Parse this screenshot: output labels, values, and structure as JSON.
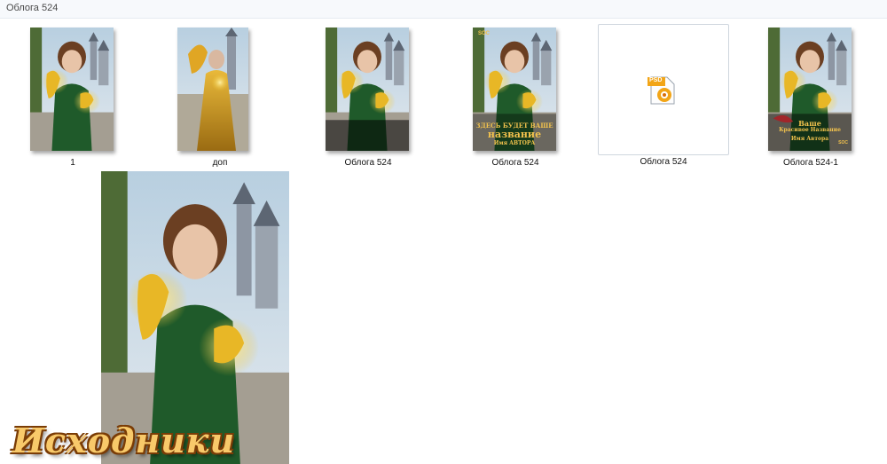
{
  "window": {
    "title": "Облога 524"
  },
  "files": [
    {
      "name": "1",
      "kind": "image"
    },
    {
      "name": "доп",
      "kind": "image"
    },
    {
      "name": "Облога  524",
      "kind": "image"
    },
    {
      "name": "Облога 524",
      "kind": "image",
      "cover_lines": [
        "ЗДЕСЬ БУДЕТ ВАШЕ",
        "название",
        "Имя АВТОРА"
      ],
      "badge": "SOC"
    },
    {
      "name": "Облога 524",
      "kind": "psd",
      "badge": "PSD"
    },
    {
      "name": "Облога 524-1",
      "kind": "image",
      "cover_lines": [
        "Ваше",
        "Красивое Название",
        "Имя Автора"
      ],
      "badge": "SOC"
    }
  ],
  "preview": {
    "kind": "image"
  },
  "watermark": {
    "text": "Исходники"
  },
  "colors": {
    "dress": "#1f5a2a",
    "dragon": "#e8b726",
    "sky": "#c9dbe8",
    "psd_badge": "#f2a517"
  }
}
